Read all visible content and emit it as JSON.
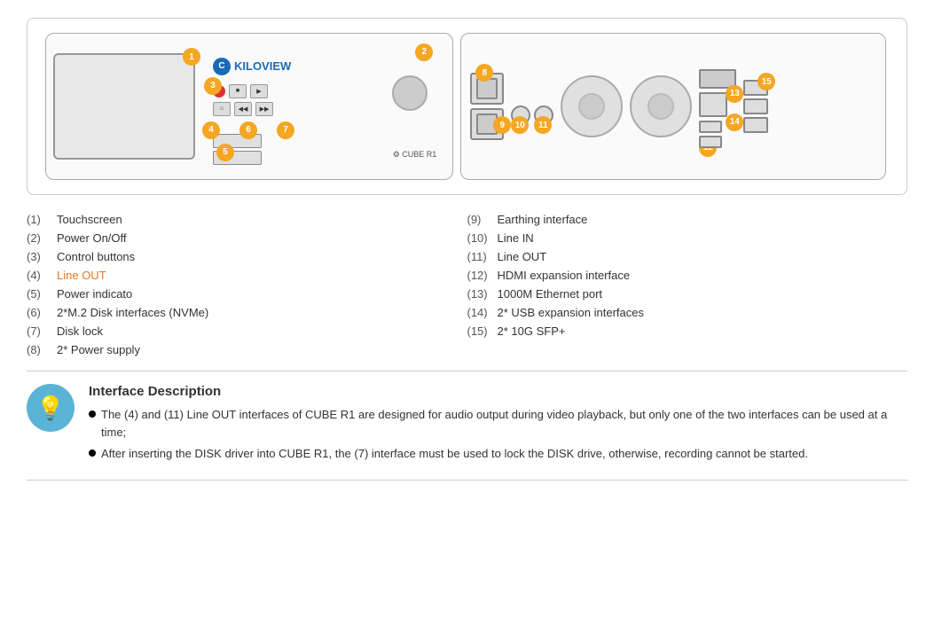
{
  "diagram": {
    "badges": {
      "b1": "1",
      "b2": "2",
      "b3": "3",
      "b4": "4",
      "b5": "5",
      "b6": "6",
      "b7": "7",
      "b8": "8",
      "b9": "9",
      "b10": "10",
      "b11": "11",
      "b12": "12",
      "b13": "13",
      "b14": "14",
      "b15": "15"
    },
    "logo_text": "KILOVIEW",
    "cube_label": "⚙ CUBE R1"
  },
  "legend": {
    "left": [
      {
        "num": "(1)",
        "text": "Touchscreen",
        "orange": false
      },
      {
        "num": "(2)",
        "text": "Power On/Off",
        "orange": false
      },
      {
        "num": "(3)",
        "text": "Control buttons",
        "orange": false
      },
      {
        "num": "(4)",
        "text": "Line OUT",
        "orange": true
      },
      {
        "num": "(5)",
        "text": "Power indicato",
        "orange": false
      },
      {
        "num": "(6)",
        "text": "2*M.2 Disk interfaces (NVMe)",
        "orange": false
      },
      {
        "num": "(7)",
        "text": "Disk lock",
        "orange": false
      },
      {
        "num": "(8)",
        "text": "2* Power supply",
        "orange": false
      }
    ],
    "right": [
      {
        "num": "(9)",
        "text": "Earthing interface",
        "orange": false
      },
      {
        "num": "(10)",
        "text": "Line IN",
        "orange": false
      },
      {
        "num": "(11)",
        "text": "Line OUT",
        "orange": false
      },
      {
        "num": "(12)",
        "text": "HDMI expansion interface",
        "orange": false
      },
      {
        "num": "(13)",
        "text": "1000M Ethernet port",
        "orange": false
      },
      {
        "num": "(14)",
        "text": "2* USB expansion interfaces",
        "orange": false
      },
      {
        "num": "(15)",
        "text": "2* 10G SFP+",
        "orange": false
      }
    ]
  },
  "info": {
    "title": "Interface Description",
    "bullets": [
      "The (4) and (11) Line OUT interfaces of CUBE R1 are designed for audio output during video playback, but only one of the two interfaces can be used at a time;",
      "After inserting the DISK driver into CUBE R1, the (7) interface must be used to lock the DISK drive, otherwise, recording cannot be started."
    ]
  }
}
